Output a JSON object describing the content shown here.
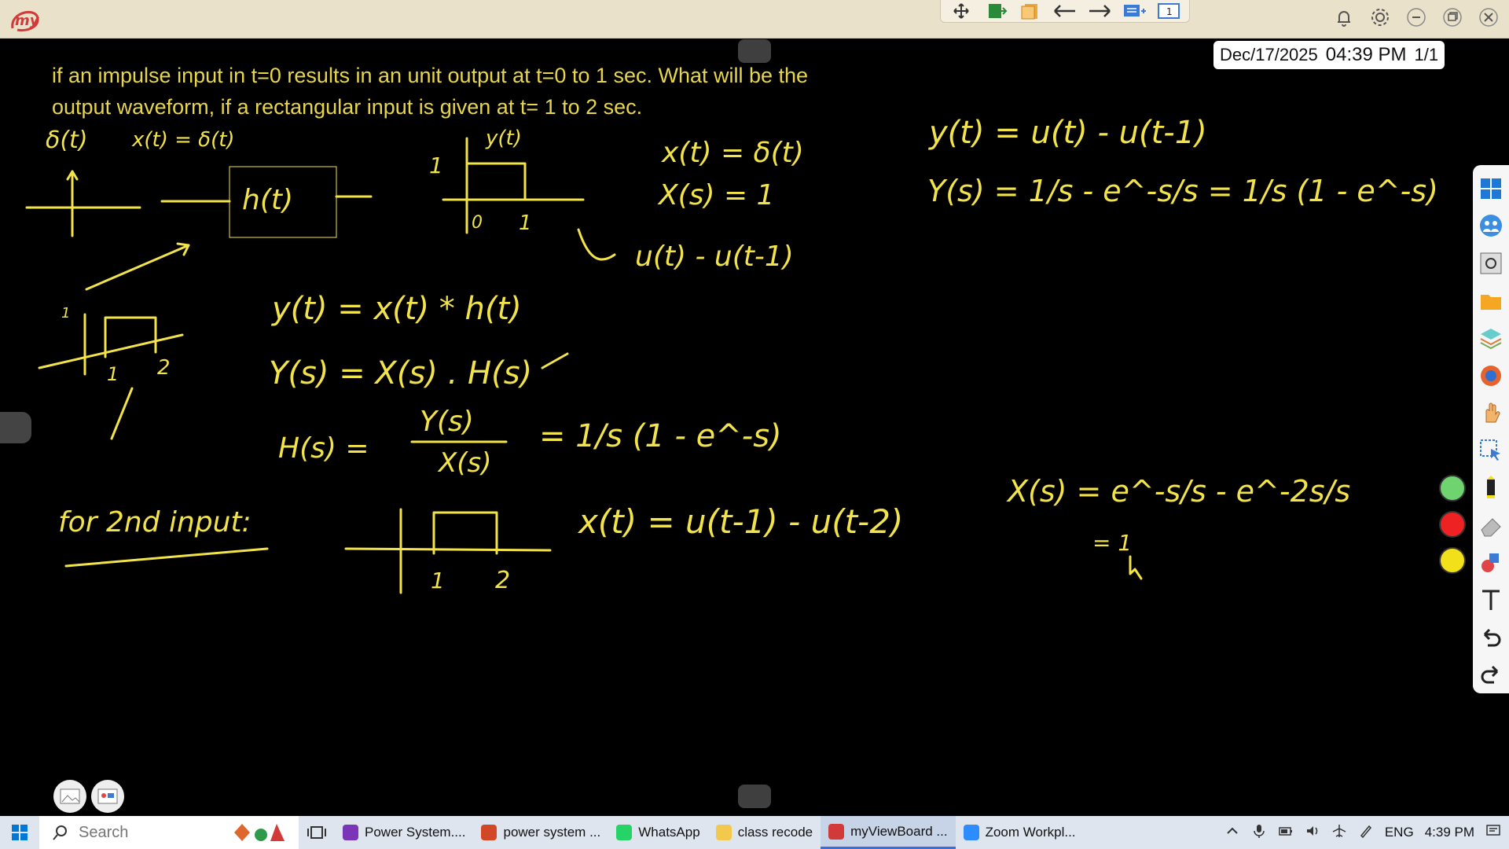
{
  "app": {
    "logo_text": "my",
    "top_tools": [
      {
        "name": "move-icon"
      },
      {
        "name": "exit-board-icon"
      },
      {
        "name": "page-icon"
      },
      {
        "name": "arrow-left-icon"
      },
      {
        "name": "arrow-right-icon"
      },
      {
        "name": "add-page-icon"
      },
      {
        "name": "page-number-icon",
        "label": "1"
      }
    ],
    "window_controls": [
      "bell-icon",
      "gear-icon",
      "minimize-icon",
      "restore-icon",
      "close-icon"
    ]
  },
  "board": {
    "question_line1": "if an impulse input in t=0 results in an unit output at t=0 to 1 sec. What will be the",
    "question_line2": "output waveform, if a rectangular input is given at t= 1 to 2 sec.",
    "date": "Dec/17/2025",
    "time": "04:39 PM",
    "page_count": "1/1",
    "ink_color": "#f2e34a",
    "notes": {
      "delta_label": "δ(t)",
      "x_delta": "x(t) = δ(t)",
      "h_box": "h(t)",
      "y_label": "y(t)",
      "one": "1",
      "zero": "0",
      "two": "2",
      "xt_delta": "x(t) = δ(t)",
      "xs_one": "X(s) = 1",
      "u_diff": "u(t) - u(t-1)",
      "yt_conv": "y(t) = x(t) * h(t)",
      "ys_prod": "Y(s) = X(s) . H(s)",
      "hs_lhs": "H(s) =",
      "hs_num": "Y(s)",
      "hs_den": "X(s)",
      "hs_rhs": "= 1/s (1 - e^-s)",
      "yt_right": "y(t) = u(t) - u(t-1)",
      "ys_right": "Y(s) = 1/s - e^-s/s = 1/s (1 - e^-s)",
      "for_2nd": "for 2nd input:",
      "xt_second": "x(t) = u(t-1) - u(t-2)",
      "xs_second": "X(s) = e^-s/s - e^-2s/s",
      "eq_one": "= 1"
    }
  },
  "palette": {
    "colors": [
      "#6fd36f",
      "#ee2222",
      "#f2e01a"
    ]
  },
  "right_toolbar": [
    "windows-icon",
    "people-icon",
    "camera-icon",
    "folder-icon",
    "layers-icon",
    "browser-icon",
    "hand-icon",
    "select-icon",
    "pen-icon",
    "eraser-icon",
    "shapes-icon",
    "text-icon",
    "undo-icon",
    "redo-icon"
  ],
  "taskbar": {
    "search_placeholder": "Search",
    "apps": [
      {
        "label": "Power System....",
        "color": "#7a35b8"
      },
      {
        "label": "power system ...",
        "color": "#d24726"
      },
      {
        "label": "WhatsApp",
        "color": "#25d366"
      },
      {
        "label": "class recode",
        "color": "#f2c94c"
      },
      {
        "label": "myViewBoard ...",
        "color": "#d23a3a"
      },
      {
        "label": "Zoom Workpl...",
        "color": "#2d8cff"
      }
    ],
    "language": "ENG",
    "clock": "4:39 PM"
  }
}
